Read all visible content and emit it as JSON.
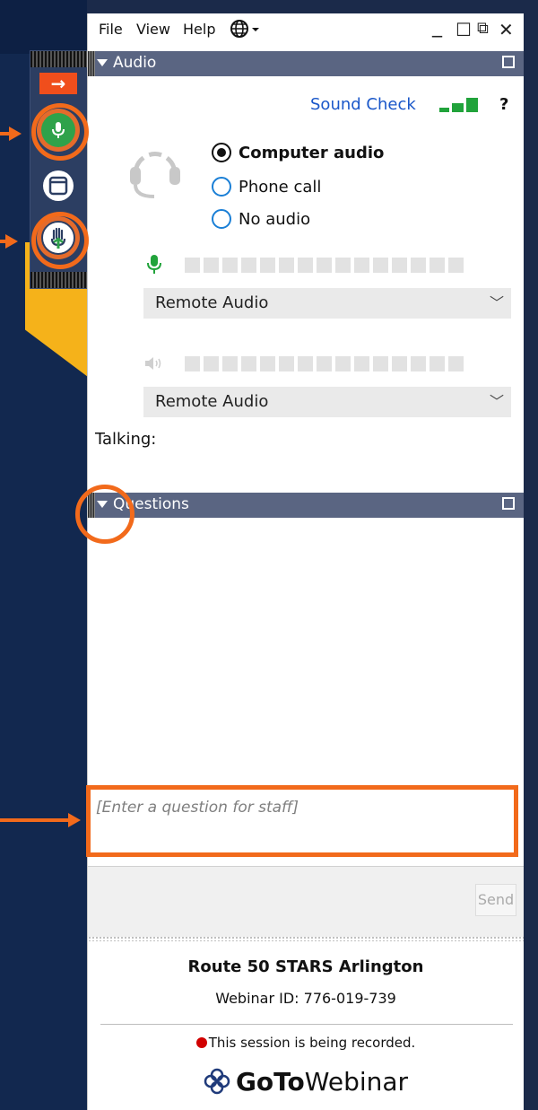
{
  "menu": {
    "file": "File",
    "view": "View",
    "help": "Help",
    "globe_icon": "globe-icon"
  },
  "window_controls": {
    "minimize": "_",
    "maximize": "☐",
    "restore": "⧉",
    "close": "✕"
  },
  "audio": {
    "title": "Audio",
    "sound_check": "Sound Check",
    "help_label": "?",
    "options": [
      {
        "label": "Computer audio",
        "selected": true
      },
      {
        "label": "Phone call",
        "selected": false
      },
      {
        "label": "No audio",
        "selected": false
      }
    ],
    "mic_device": "Remote Audio",
    "speaker_device": "Remote Audio",
    "talking_label": "Talking:",
    "colors": {
      "accent": "#1a57c9",
      "level": "#21a33b"
    }
  },
  "questions": {
    "title": "Questions",
    "input_placeholder": "[Enter a question for staff]",
    "send_label": "Send"
  },
  "webinar": {
    "name": "Route 50 STARS Arlington",
    "id_text": "Webinar ID: 776-019-739",
    "recording_text": "This session is being recorded.",
    "logo_bold": "GoTo",
    "logo_rest": "Webinar"
  },
  "annotation_color": "#f26a1b"
}
